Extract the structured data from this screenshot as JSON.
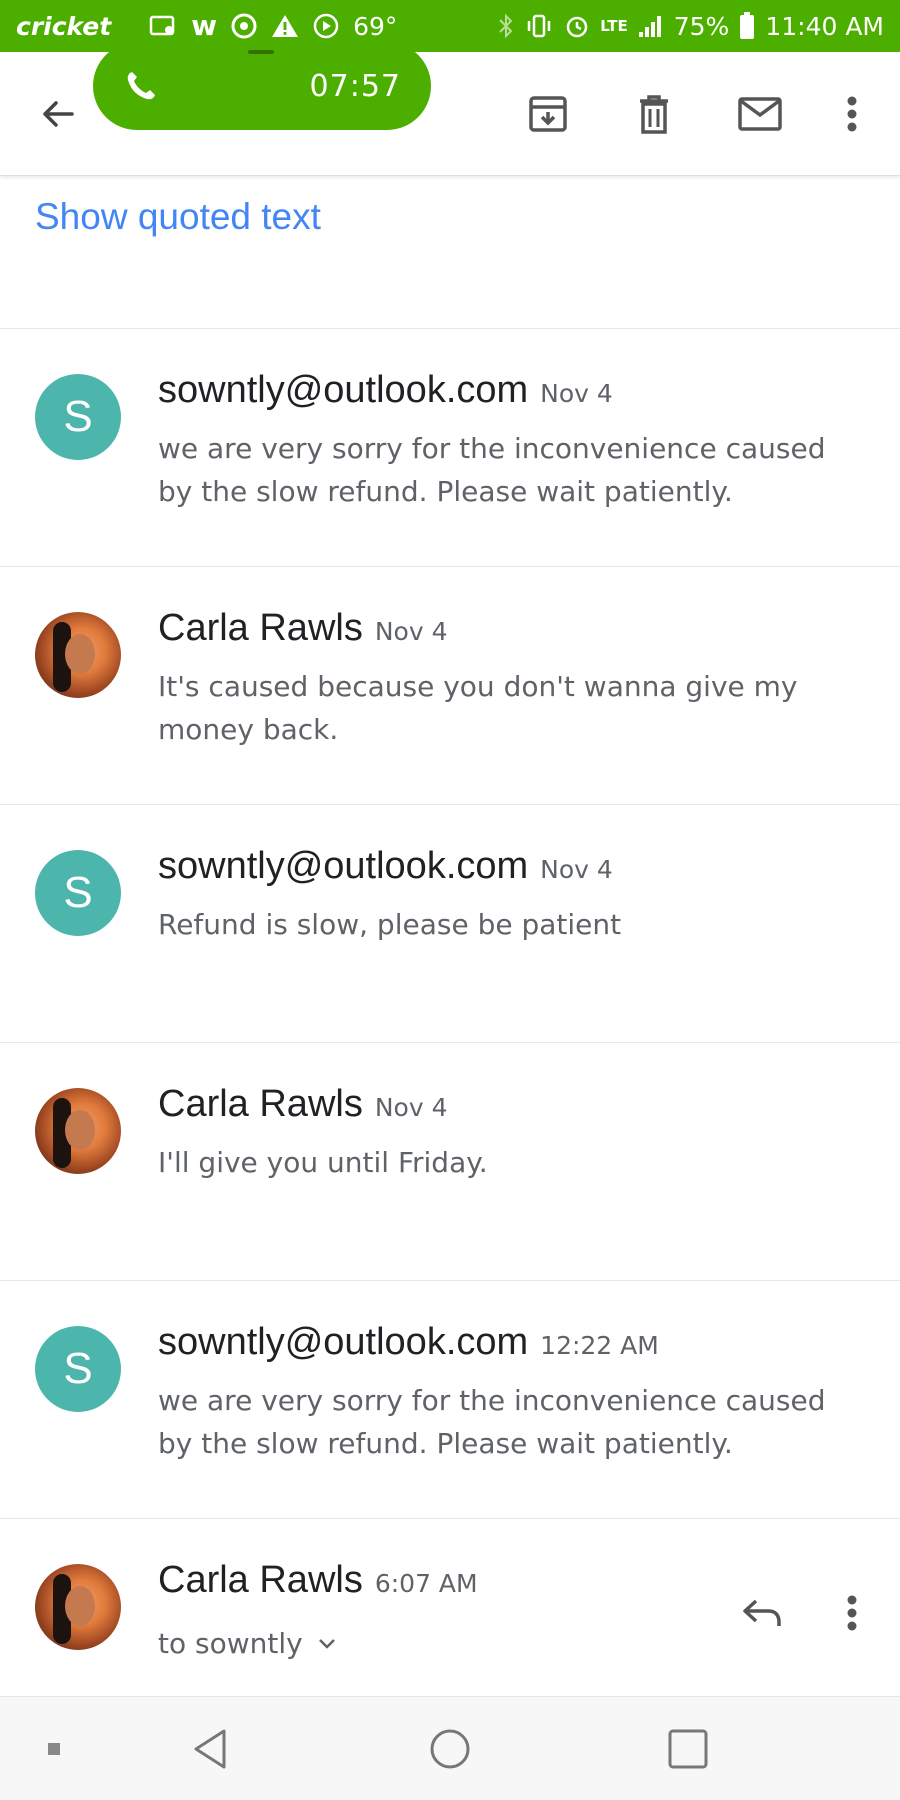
{
  "status_bar": {
    "carrier": "cricket",
    "temperature": "69°",
    "battery": "75%",
    "time": "11:40 AM",
    "network": "LTE"
  },
  "call": {
    "timer": "07:57"
  },
  "toolbar": {
    "archive_icon": "archive-icon",
    "delete_icon": "trash-icon",
    "mail_icon": "mail-icon",
    "more_icon": "more-vert-icon"
  },
  "show_quoted_text": "Show quoted text",
  "messages": [
    {
      "sender": "sowntly@outlook.com",
      "date": "Nov 4",
      "snippet": "we are very sorry for the inconvenience caused by the slow refund. Please wait patiently.",
      "avatar_letter": "S"
    },
    {
      "sender": "Carla Rawls",
      "date": "Nov 4",
      "snippet": "It's caused because you don't wanna give my money back."
    },
    {
      "sender": "sowntly@outlook.com",
      "date": "Nov 4",
      "snippet": "Refund is slow, please be patient",
      "avatar_letter": "S"
    },
    {
      "sender": "Carla Rawls",
      "date": "Nov 4",
      "snippet": "I'll give you until Friday."
    },
    {
      "sender": "sowntly@outlook.com",
      "date": "12:22 AM",
      "snippet": "we are very sorry for the inconvenience caused by the slow refund. Please wait patiently.",
      "avatar_letter": "S"
    }
  ],
  "expanded_message": {
    "sender": "Carla Rawls",
    "date": "6:07 AM",
    "to": "to sowntly"
  },
  "colors": {
    "status_green": "#4caf00",
    "link_blue": "#4285f4",
    "avatar_teal": "#4db6ac"
  }
}
